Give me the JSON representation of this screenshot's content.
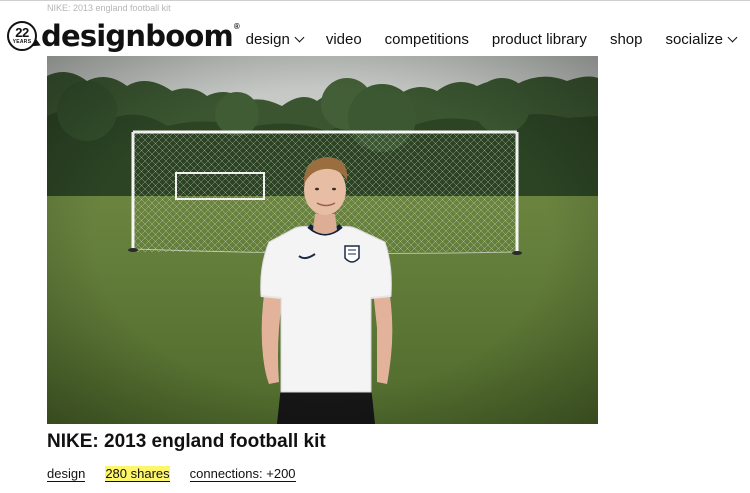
{
  "breadcrumb": "NIKE: 2013 england football kit",
  "logo": {
    "badge_number": "22",
    "badge_text": "YEARS",
    "wordmark": "designboom",
    "registered_mark": "®"
  },
  "nav": {
    "items": [
      {
        "label": "design",
        "has_dropdown": true
      },
      {
        "label": "video",
        "has_dropdown": false
      },
      {
        "label": "competitions",
        "has_dropdown": false
      },
      {
        "label": "product library",
        "has_dropdown": false
      },
      {
        "label": "shop",
        "has_dropdown": false
      },
      {
        "label": "socialize",
        "has_dropdown": true
      }
    ]
  },
  "hero": {
    "subject": "young man in white England football shirt standing on grass before a football goal",
    "colors": {
      "sky": "#c9cdc8",
      "grass": "#5e7a36",
      "trees": "#2f4a27",
      "shirt": "#f2f2f2"
    }
  },
  "article": {
    "title": "NIKE: 2013 england football kit",
    "meta": {
      "category": "design",
      "shares": "280 shares",
      "connections": "connections: +200"
    },
    "highlight_color": "#fdf56a"
  }
}
